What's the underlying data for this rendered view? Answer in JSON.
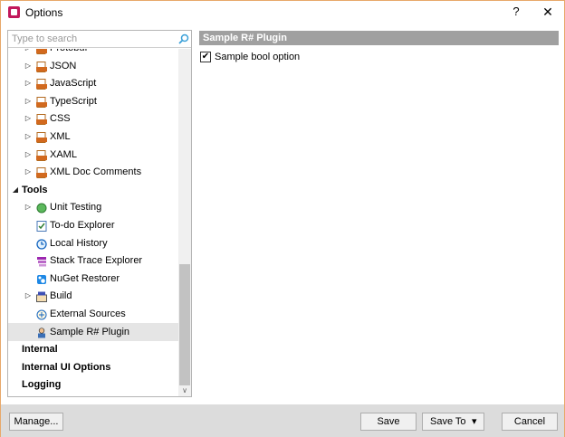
{
  "window": {
    "title": "Options"
  },
  "titlebar": {
    "help": "?",
    "close": "✕"
  },
  "search": {
    "placeholder": "Type to search"
  },
  "tree": {
    "items": [
      {
        "label": "Protobuf",
        "level": 1,
        "expander": "▷",
        "icon": "file-icon"
      },
      {
        "label": "JSON",
        "level": 1,
        "expander": "▷",
        "icon": "file-icon"
      },
      {
        "label": "JavaScript",
        "level": 1,
        "expander": "▷",
        "icon": "file-icon"
      },
      {
        "label": "TypeScript",
        "level": 1,
        "expander": "▷",
        "icon": "file-icon"
      },
      {
        "label": "CSS",
        "level": 1,
        "expander": "▷",
        "icon": "file-icon"
      },
      {
        "label": "XML",
        "level": 1,
        "expander": "▷",
        "icon": "file-icon"
      },
      {
        "label": "XAML",
        "level": 1,
        "expander": "▷",
        "icon": "file-icon"
      },
      {
        "label": "XML Doc Comments",
        "level": 1,
        "expander": "▷",
        "icon": "file-icon"
      },
      {
        "label": "Tools",
        "level": 0,
        "expander": "◢",
        "bold": true
      },
      {
        "label": "Unit Testing",
        "level": 1,
        "expander": "▷",
        "icon": "green-circle-icon"
      },
      {
        "label": "To-do Explorer",
        "level": 1,
        "icon": "checklist-icon"
      },
      {
        "label": "Local History",
        "level": 1,
        "icon": "history-icon"
      },
      {
        "label": "Stack Trace Explorer",
        "level": 1,
        "icon": "stack-trace-icon"
      },
      {
        "label": "NuGet Restorer",
        "level": 1,
        "icon": "nuget-icon"
      },
      {
        "label": "Build",
        "level": 1,
        "expander": "▷",
        "icon": "build-icon"
      },
      {
        "label": "External Sources",
        "level": 1,
        "icon": "external-sources-icon"
      },
      {
        "label": "Sample R# Plugin",
        "level": 1,
        "icon": "plugin-icon",
        "selected": true
      },
      {
        "label": "Internal",
        "level": 0,
        "bold": true
      },
      {
        "label": "Internal UI Options",
        "level": 0,
        "bold": true
      },
      {
        "label": "Logging",
        "level": 0,
        "bold": true
      }
    ]
  },
  "content": {
    "header": "Sample R# Plugin",
    "option_label": "Sample bool option",
    "option_checked": true,
    "check_mark": "✔"
  },
  "buttons": {
    "manage": "Manage...",
    "save": "Save",
    "save_to": "Save To",
    "save_to_arrow": "▾",
    "cancel": "Cancel"
  },
  "colors": {
    "header_bg": "#a0a0a0",
    "selected_bg": "#e5e5e5",
    "footer_bg": "#dcdcdc",
    "window_border": "#e8a86a"
  }
}
